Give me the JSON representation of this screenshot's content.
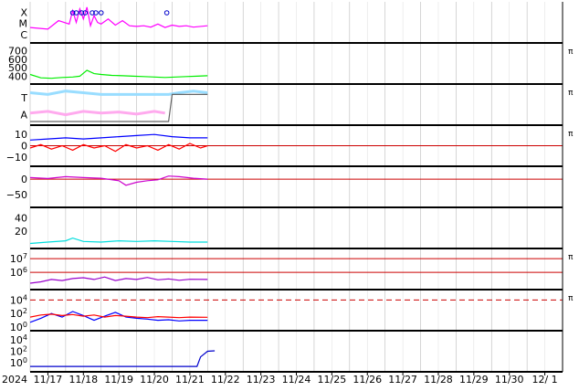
{
  "chart_data": {
    "type": "line",
    "year_label": "2024",
    "x_axis": {
      "ticks": [
        "11/17",
        "11/18",
        "11/19",
        "11/20",
        "11/21",
        "11/22",
        "11/23",
        "11/24",
        "11/25",
        "11/26",
        "11/27",
        "11/28",
        "11/29",
        "11/30",
        "12/ 1"
      ],
      "range": [
        "2024-11-16",
        "2024-12-01"
      ]
    },
    "grid": true,
    "panels": [
      {
        "id": "xray-class",
        "y_tick_labels": [
          "X",
          "M",
          "C"
        ],
        "side_marker": "",
        "series": [
          {
            "color": "#ff00ff",
            "shape": "flare",
            "points": [
              [
                0.0,
                0.35
              ],
              [
                0.5,
                0.3
              ],
              [
                0.8,
                0.55
              ],
              [
                1.1,
                0.45
              ],
              [
                1.2,
                0.85
              ],
              [
                1.3,
                0.5
              ],
              [
                1.4,
                0.9
              ],
              [
                1.5,
                0.6
              ],
              [
                1.6,
                0.95
              ],
              [
                1.7,
                0.4
              ],
              [
                1.8,
                0.7
              ],
              [
                1.9,
                0.5
              ],
              [
                2.0,
                0.45
              ],
              [
                2.2,
                0.6
              ],
              [
                2.4,
                0.42
              ],
              [
                2.6,
                0.55
              ],
              [
                2.8,
                0.4
              ],
              [
                3.0,
                0.38
              ],
              [
                3.2,
                0.4
              ],
              [
                3.4,
                0.36
              ],
              [
                3.6,
                0.45
              ],
              [
                3.8,
                0.35
              ],
              [
                4.0,
                0.42
              ],
              [
                4.2,
                0.38
              ],
              [
                4.4,
                0.4
              ],
              [
                4.6,
                0.36
              ],
              [
                5.0,
                0.4
              ]
            ]
          }
        ],
        "events": [
          1.2,
          1.3,
          1.45,
          1.55,
          1.75,
          1.85,
          2.0,
          3.85
        ]
      },
      {
        "id": "solar-wind-speed",
        "y_tick_labels": [
          "700",
          "600",
          "500",
          "400"
        ],
        "ylim": [
          350,
          750
        ],
        "side_marker": "π",
        "series": [
          {
            "color": "#00ee00",
            "points": [
              [
                0.0,
                420
              ],
              [
                0.3,
                380
              ],
              [
                0.6,
                375
              ],
              [
                0.9,
                385
              ],
              [
                1.2,
                390
              ],
              [
                1.4,
                400
              ],
              [
                1.6,
                470
              ],
              [
                1.8,
                430
              ],
              [
                2.0,
                420
              ],
              [
                2.3,
                410
              ],
              [
                2.6,
                405
              ],
              [
                2.9,
                400
              ],
              [
                3.2,
                395
              ],
              [
                3.5,
                390
              ],
              [
                3.8,
                385
              ],
              [
                4.1,
                390
              ],
              [
                4.4,
                395
              ],
              [
                4.7,
                400
              ],
              [
                5.0,
                405
              ]
            ]
          }
        ]
      },
      {
        "id": "mag-sector",
        "y_tick_labels": [
          "T",
          "A"
        ],
        "side_marker": "π",
        "series": [
          {
            "color": "#ffaaee",
            "role": "away",
            "points": [
              [
                0.0,
                0.25
              ],
              [
                0.5,
                0.3
              ],
              [
                1.0,
                0.2
              ],
              [
                1.5,
                0.3
              ],
              [
                2.0,
                0.25
              ],
              [
                2.5,
                0.28
              ],
              [
                3.0,
                0.22
              ],
              [
                3.5,
                0.3
              ],
              [
                3.8,
                0.25
              ]
            ]
          },
          {
            "color": "#99ddff",
            "role": "toward",
            "points": [
              [
                0.0,
                0.85
              ],
              [
                0.5,
                0.8
              ],
              [
                1.0,
                0.9
              ],
              [
                1.5,
                0.85
              ],
              [
                2.0,
                0.8
              ],
              [
                3.9,
                0.8
              ],
              [
                4.2,
                0.85
              ],
              [
                4.6,
                0.9
              ],
              [
                5.0,
                0.85
              ]
            ]
          },
          {
            "color": "#666666",
            "role": "polarity",
            "points": [
              [
                0.0,
                0.0
              ],
              [
                3.7,
                0.0
              ],
              [
                3.9,
                0.0
              ],
              [
                4.0,
                0.8
              ],
              [
                5.0,
                0.8
              ]
            ]
          }
        ]
      },
      {
        "id": "imf",
        "y_tick_labels": [
          "10",
          "0",
          "−10"
        ],
        "ylim": [
          -15,
          15
        ],
        "zero_line": 0,
        "side_marker": "π",
        "series": [
          {
            "color": "#0000ff",
            "name": "",
            "points": [
              [
                0.0,
                5
              ],
              [
                0.5,
                6
              ],
              [
                1.0,
                7
              ],
              [
                1.5,
                6
              ],
              [
                2.0,
                7
              ],
              [
                2.5,
                8
              ],
              [
                3.0,
                9
              ],
              [
                3.5,
                10
              ],
              [
                4.0,
                8
              ],
              [
                4.5,
                7
              ],
              [
                5.0,
                7
              ]
            ]
          },
          {
            "color": "#ff0000",
            "name": "",
            "points": [
              [
                0.0,
                -2
              ],
              [
                0.3,
                1
              ],
              [
                0.6,
                -3
              ],
              [
                0.9,
                0
              ],
              [
                1.2,
                -4
              ],
              [
                1.5,
                1
              ],
              [
                1.8,
                -2
              ],
              [
                2.1,
                0
              ],
              [
                2.4,
                -5
              ],
              [
                2.7,
                1
              ],
              [
                3.0,
                -2
              ],
              [
                3.3,
                0
              ],
              [
                3.6,
                -4
              ],
              [
                3.9,
                1
              ],
              [
                4.2,
                -3
              ],
              [
                4.5,
                2
              ],
              [
                4.8,
                -2
              ],
              [
                5.0,
                0
              ]
            ]
          }
        ]
      },
      {
        "id": "dst",
        "y_tick_labels": [
          "0",
          "−50"
        ],
        "ylim": [
          -80,
          30
        ],
        "zero_line": 0,
        "side_marker": "",
        "series": [
          {
            "color": "#cc00cc",
            "points": [
              [
                0.0,
                5
              ],
              [
                0.5,
                2
              ],
              [
                1.0,
                8
              ],
              [
                1.5,
                5
              ],
              [
                2.0,
                3
              ],
              [
                2.5,
                -5
              ],
              [
                2.7,
                -20
              ],
              [
                3.0,
                -10
              ],
              [
                3.3,
                -5
              ],
              [
                3.6,
                -2
              ],
              [
                3.9,
                10
              ],
              [
                4.2,
                8
              ],
              [
                4.6,
                3
              ],
              [
                5.0,
                0
              ]
            ]
          }
        ]
      },
      {
        "id": "kp",
        "y_tick_labels": [
          "40",
          "20"
        ],
        "ylim": [
          0,
          50
        ],
        "side_marker": "",
        "series": [
          {
            "color": "#00dddd",
            "points": [
              [
                0.0,
                2
              ],
              [
                0.5,
                4
              ],
              [
                1.0,
                6
              ],
              [
                1.2,
                10
              ],
              [
                1.5,
                5
              ],
              [
                2.0,
                4
              ],
              [
                2.5,
                6
              ],
              [
                3.0,
                5
              ],
              [
                3.5,
                6
              ],
              [
                4.0,
                5
              ],
              [
                4.5,
                4
              ],
              [
                5.0,
                4
              ]
            ]
          }
        ]
      },
      {
        "id": "electron-flux",
        "y_tick_labels": [
          "10^7",
          "10^6"
        ],
        "log": true,
        "ylim": [
          100000,
          30000000
        ],
        "threshold_lines": [
          10000000,
          1000000
        ],
        "side_marker": "π",
        "series": [
          {
            "color": "#9900cc",
            "points": [
              [
                0.0,
                160000
              ],
              [
                0.3,
                200000
              ],
              [
                0.6,
                300000
              ],
              [
                0.9,
                250000
              ],
              [
                1.2,
                350000
              ],
              [
                1.5,
                400000
              ],
              [
                1.8,
                300000
              ],
              [
                2.1,
                450000
              ],
              [
                2.4,
                250000
              ],
              [
                2.7,
                350000
              ],
              [
                3.0,
                300000
              ],
              [
                3.3,
                420000
              ],
              [
                3.6,
                280000
              ],
              [
                3.9,
                330000
              ],
              [
                4.2,
                260000
              ],
              [
                4.5,
                310000
              ],
              [
                5.0,
                300000
              ]
            ]
          }
        ]
      },
      {
        "id": "proton-flux",
        "y_tick_labels": [
          "10^4",
          "10^2",
          "10^0"
        ],
        "log": true,
        "ylim": [
          1,
          100000
        ],
        "threshold_lines": [
          10000
        ],
        "side_marker": "π",
        "series": [
          {
            "color": "#0000ff",
            "points": [
              [
                0.0,
                5
              ],
              [
                0.3,
                20
              ],
              [
                0.6,
                100
              ],
              [
                0.9,
                30
              ],
              [
                1.2,
                200
              ],
              [
                1.5,
                50
              ],
              [
                1.8,
                10
              ],
              [
                2.1,
                40
              ],
              [
                2.4,
                150
              ],
              [
                2.7,
                30
              ],
              [
                3.0,
                20
              ],
              [
                3.3,
                15
              ],
              [
                3.6,
                10
              ],
              [
                3.9,
                12
              ],
              [
                4.2,
                8
              ],
              [
                4.5,
                10
              ],
              [
                5.0,
                10
              ]
            ]
          },
          {
            "color": "#ff0000",
            "points": [
              [
                0.0,
                30
              ],
              [
                0.3,
                60
              ],
              [
                0.6,
                80
              ],
              [
                0.9,
                50
              ],
              [
                1.2,
                70
              ],
              [
                1.5,
                40
              ],
              [
                1.8,
                60
              ],
              [
                2.1,
                30
              ],
              [
                2.4,
                50
              ],
              [
                2.7,
                40
              ],
              [
                3.0,
                30
              ],
              [
                3.3,
                25
              ],
              [
                3.6,
                35
              ],
              [
                3.9,
                30
              ],
              [
                4.2,
                25
              ],
              [
                4.5,
                30
              ],
              [
                5.0,
                28
              ]
            ]
          }
        ]
      },
      {
        "id": "neutron",
        "y_tick_labels": [
          "10^4",
          "10^2",
          "10^0"
        ],
        "log": true,
        "ylim": [
          0.1,
          100000
        ],
        "side_marker": "",
        "series": [
          {
            "color": "#0000cc",
            "points": [
              [
                0.0,
                0.2
              ],
              [
                1.0,
                0.2
              ],
              [
                2.0,
                0.2
              ],
              [
                3.0,
                0.2
              ],
              [
                4.0,
                0.2
              ],
              [
                4.7,
                0.2
              ],
              [
                4.8,
                10
              ],
              [
                5.0,
                100
              ],
              [
                5.2,
                120
              ]
            ]
          }
        ]
      }
    ]
  }
}
